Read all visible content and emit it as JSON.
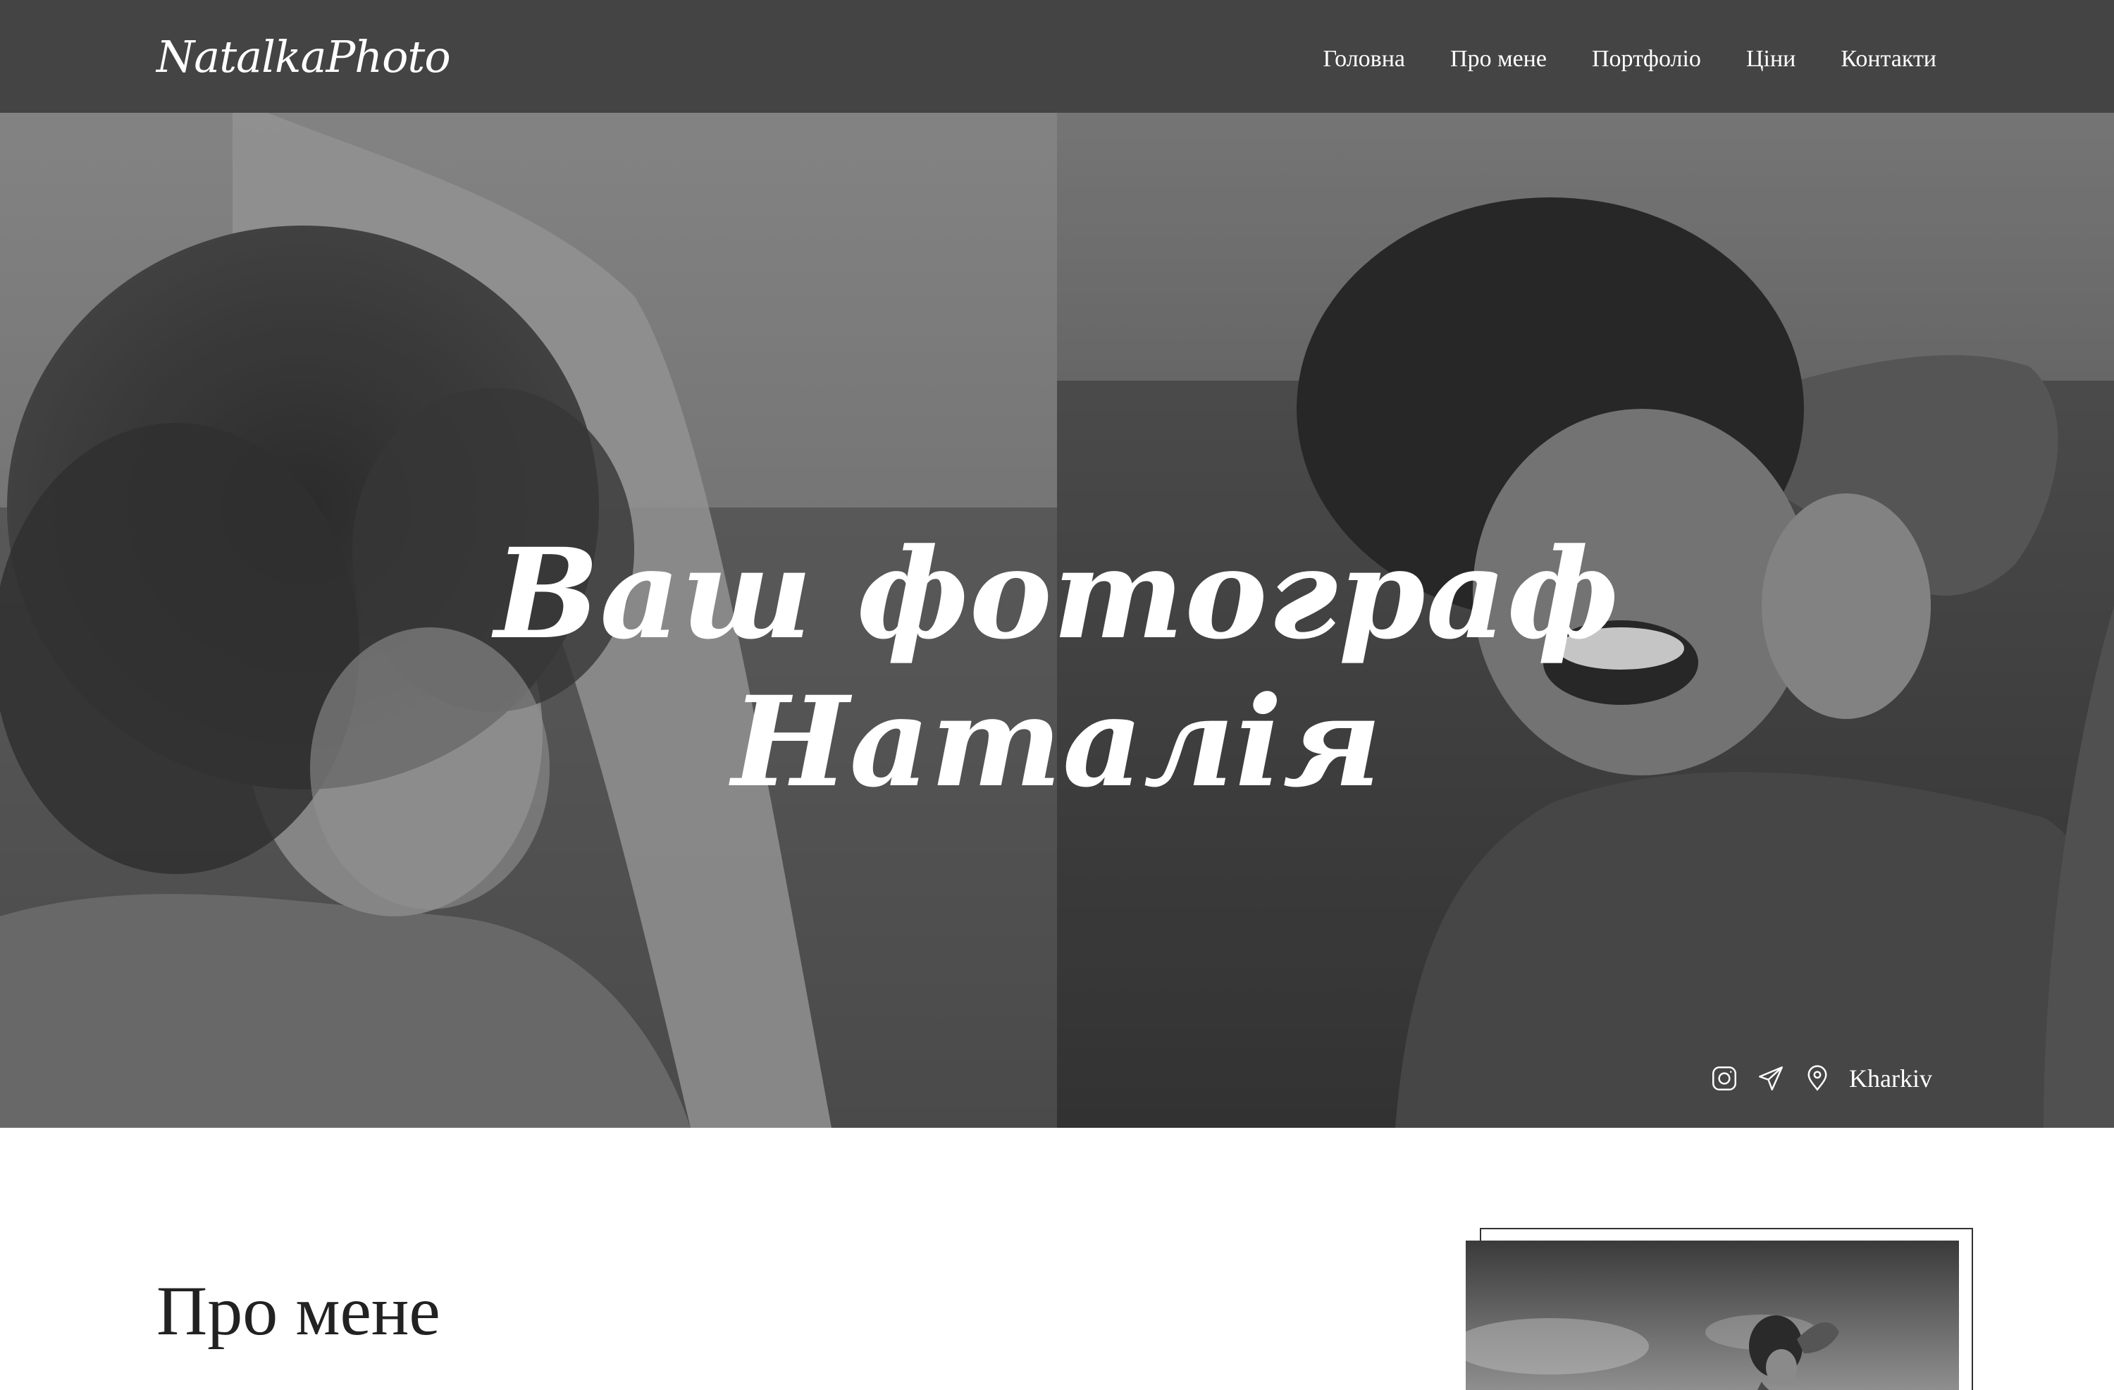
{
  "header": {
    "logo_text": "NatalkaPhoto",
    "nav": [
      {
        "label": "Головна"
      },
      {
        "label": "Про мене"
      },
      {
        "label": "Портфоліо"
      },
      {
        "label": "Ціни"
      },
      {
        "label": "Контакти"
      }
    ]
  },
  "hero": {
    "title_line1": "Ваш фотограф",
    "title_line2": "Наталія",
    "social": {
      "icons": [
        "instagram-icon",
        "telegram-icon",
        "location-pin-icon"
      ],
      "location_label": "Kharkiv"
    }
  },
  "about": {
    "title": "Про мене"
  },
  "colors": {
    "header_bg": "#444444",
    "text_light": "#ffffff",
    "text_dark": "#222222",
    "page_bg": "#ffffff"
  }
}
